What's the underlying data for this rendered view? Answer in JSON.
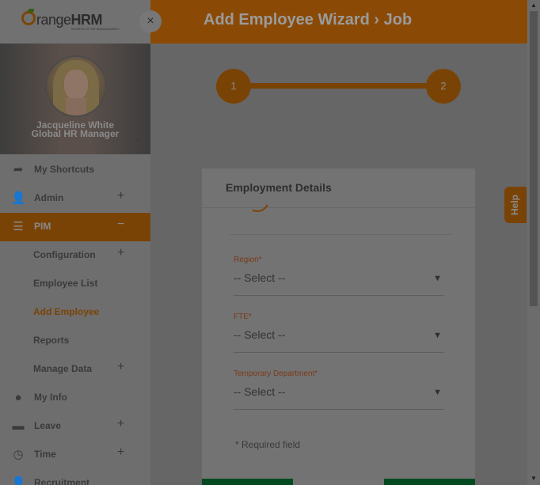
{
  "header": {
    "title": "Add Employee Wizard › Job"
  },
  "brand": {
    "logo_text_a": "range",
    "logo_text_b": "HRM",
    "logo_sub": "SOURCE OF HR MANAGEMENT",
    "accent": "#f28c0f"
  },
  "profile": {
    "name": "Jacqueline White",
    "role": "Global HR Manager"
  },
  "sidebar": {
    "items": [
      {
        "label": "My Shortcuts",
        "icon": "share-arrow-icon"
      },
      {
        "label": "Admin",
        "icon": "admin-user-gear-icon"
      },
      {
        "label": "PIM",
        "icon": "pim-card-icon"
      },
      {
        "label": "Configuration"
      },
      {
        "label": "Employee List"
      },
      {
        "label": "Add Employee"
      },
      {
        "label": "Reports"
      },
      {
        "label": "Manage Data"
      },
      {
        "label": "My Info",
        "icon": "user-circle-icon"
      },
      {
        "label": "Leave",
        "icon": "briefcase-icon"
      },
      {
        "label": "Time",
        "icon": "clock-icon"
      },
      {
        "label": "Recruitment",
        "icon": "recruitment-user-icon"
      }
    ]
  },
  "wizard": {
    "step1": "1",
    "step2": "2"
  },
  "form": {
    "section_title": "Employment Details",
    "region_label": "Region",
    "region_value": "-- Select --",
    "fte_label": "FTE",
    "fte_value": "-- Select --",
    "temp_dept_label": "Temporary Department",
    "temp_dept_value": "-- Select --",
    "required_mark": "*",
    "required_note": "* Required field"
  },
  "help": {
    "label": "Help"
  }
}
